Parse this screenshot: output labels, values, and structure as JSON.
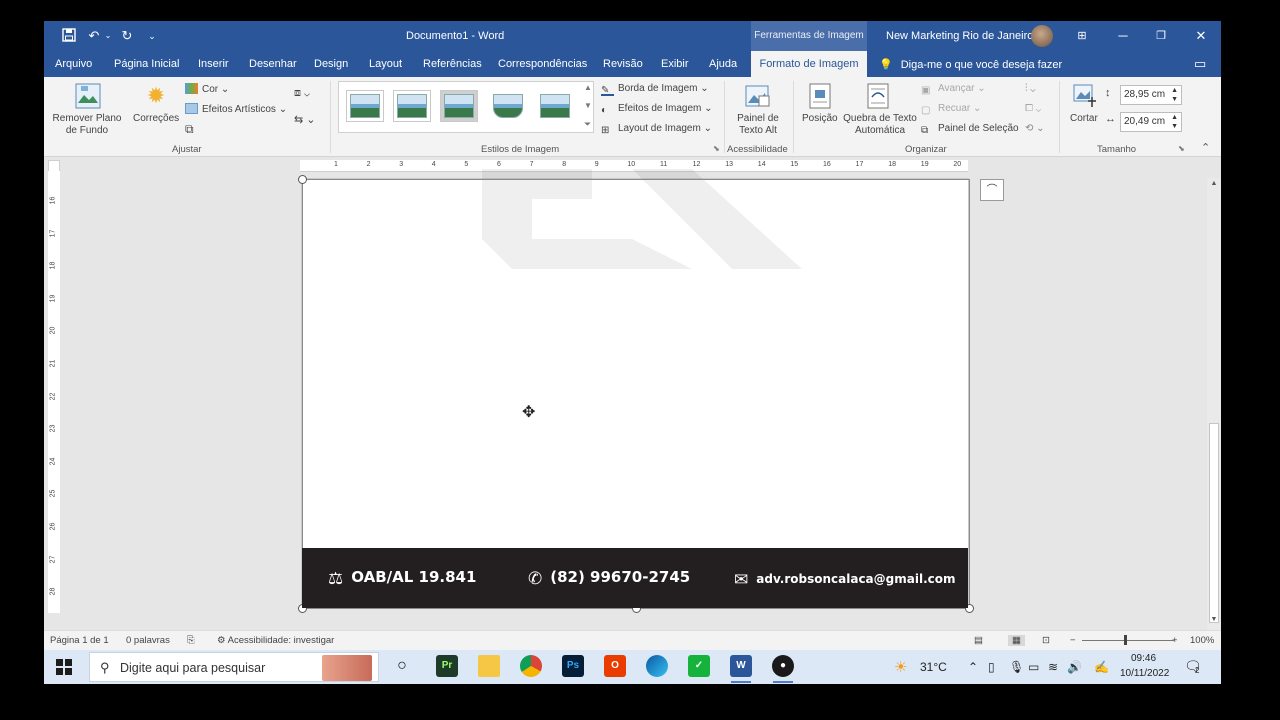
{
  "window": {
    "title": "Documento1  -  Word",
    "tools_tab": "Ferramentas de Imagem",
    "account": "New Marketing Rio de Janeiro"
  },
  "tabs": [
    {
      "label": "Arquivo"
    },
    {
      "label": "Página Inicial"
    },
    {
      "label": "Inserir"
    },
    {
      "label": "Desenhar"
    },
    {
      "label": "Design"
    },
    {
      "label": "Layout"
    },
    {
      "label": "Referências"
    },
    {
      "label": "Correspondências"
    },
    {
      "label": "Revisão"
    },
    {
      "label": "Exibir"
    },
    {
      "label": "Ajuda"
    },
    {
      "label": "Formato de Imagem"
    }
  ],
  "tell_me": "Diga-me o que você deseja fazer",
  "ribbon": {
    "ajustar": {
      "remover_fundo": "Remover Plano de Fundo",
      "correcoes": "Correções",
      "cor": "Cor",
      "efeitos_artisticos": "Efeitos Artísticos",
      "group_label": "Ajustar"
    },
    "estilos": {
      "borda": "Borda de Imagem",
      "efeitos": "Efeitos de Imagem",
      "layout": "Layout de Imagem",
      "group_label": "Estilos de Imagem"
    },
    "acessibilidade": {
      "painel_alt": "Painel de Texto Alt",
      "group_label": "Acessibilidade"
    },
    "organizar": {
      "posicao": "Posição",
      "quebra": "Quebra de Texto Automática",
      "avancar": "Avançar",
      "recuar": "Recuar",
      "painel_selecao": "Painel de Seleção",
      "group_label": "Organizar"
    },
    "tamanho": {
      "cortar": "Cortar",
      "height": "28,95 cm",
      "width": "20,49 cm",
      "group_label": "Tamanho"
    }
  },
  "hruler_ticks": [
    "1",
    "2",
    "3",
    "4",
    "5",
    "6",
    "7",
    "8",
    "9",
    "10",
    "11",
    "12",
    "13",
    "14",
    "15",
    "16",
    "17",
    "18",
    "19",
    "20"
  ],
  "vruler_ticks": [
    "16",
    "17",
    "18",
    "19",
    "20",
    "21",
    "22",
    "23",
    "24",
    "25",
    "26",
    "27",
    "28"
  ],
  "document": {
    "footer": {
      "oab": "OAB/AL 19.841",
      "phone": "(82) 99670-2745",
      "email": "adv.robsoncalaca@gmail.com"
    }
  },
  "status": {
    "page": "Página 1 de 1",
    "words": "0 palavras",
    "accessibility": "Acessibilidade: investigar",
    "zoom": "100%"
  },
  "taskbar": {
    "search_placeholder": "Digite aqui para pesquisar",
    "weather": "31°C",
    "time": "09:46",
    "date": "10/11/2022",
    "notifications": "2"
  }
}
